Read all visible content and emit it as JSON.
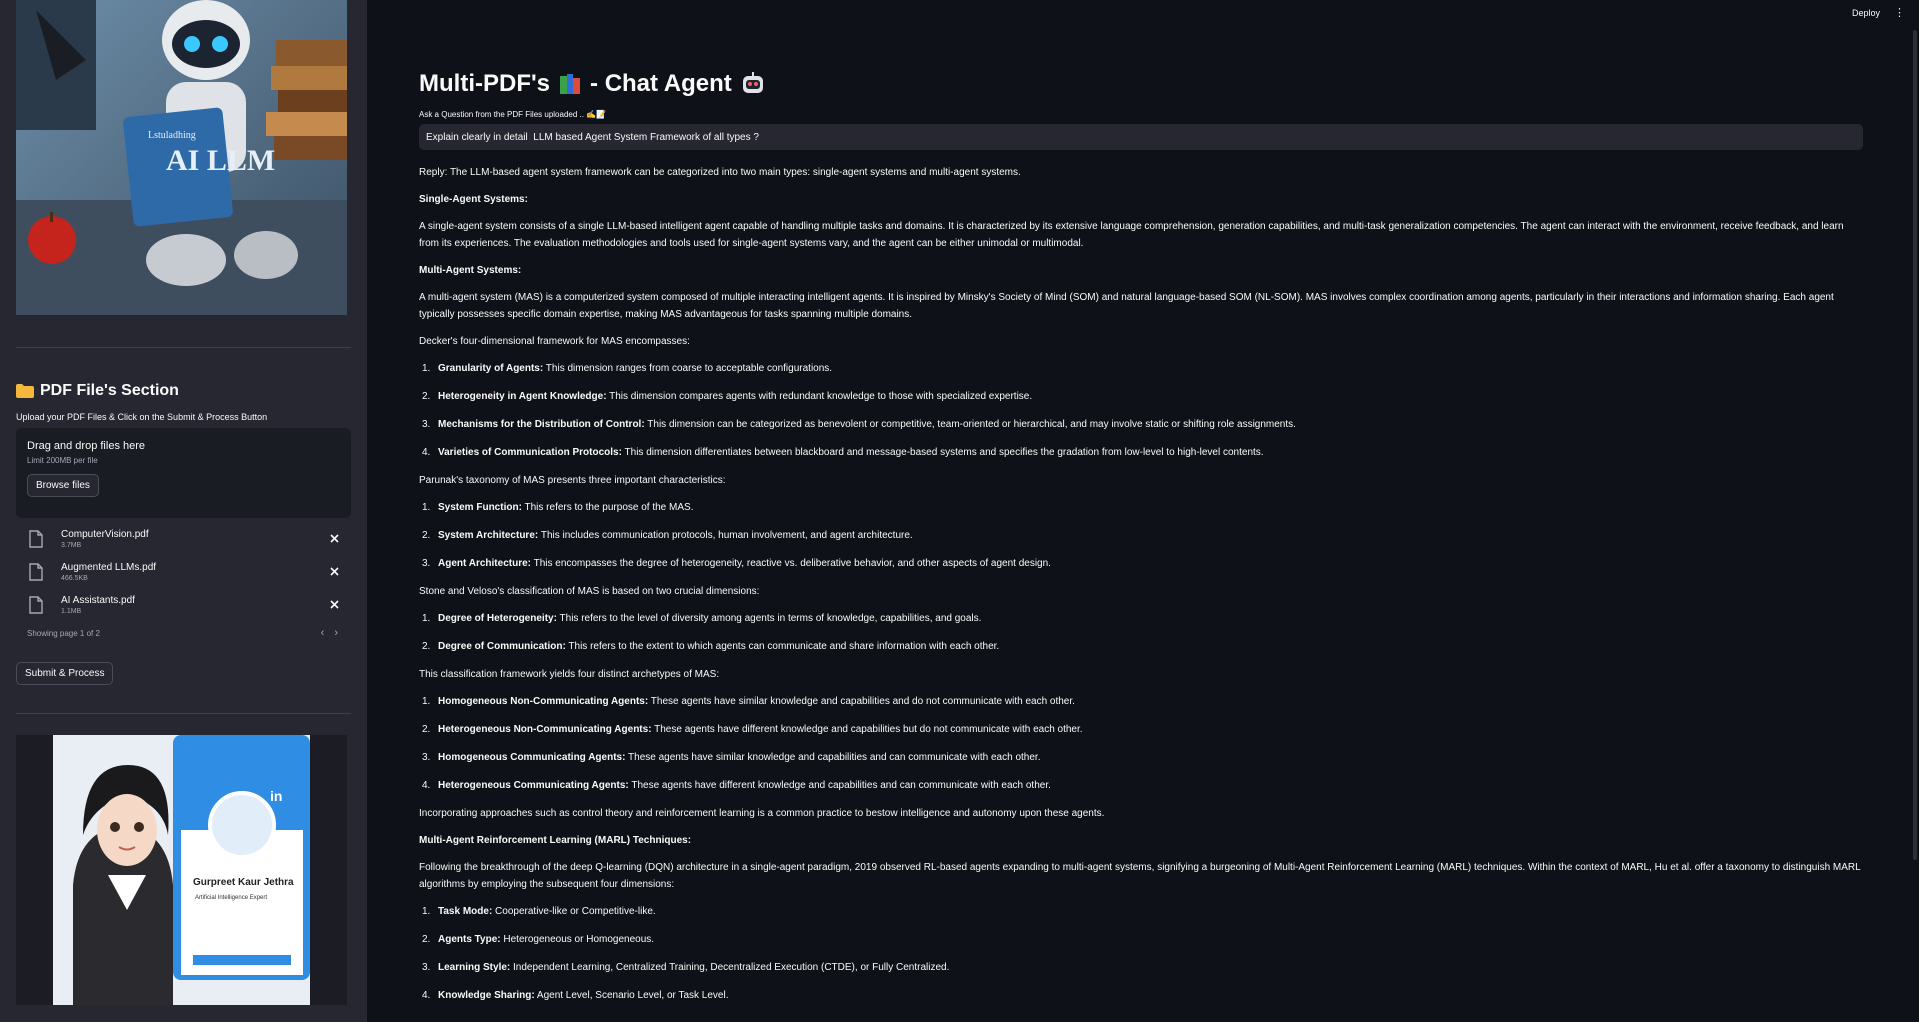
{
  "topbar": {
    "deploy_label": "Deploy",
    "menu_label": "⋮"
  },
  "sidebar": {
    "section_title": "PDF File's Section",
    "helper_text": "Upload your PDF Files & Click on the Submit & Process Button",
    "dropzone": {
      "title": "Drag and drop files here",
      "limit": "Limit 200MB per file",
      "browse_label": "Browse files"
    },
    "files": [
      {
        "name": "ComputerVision.pdf",
        "size": "3.7MB"
      },
      {
        "name": "Augmented LLMs.pdf",
        "size": "466.5KB"
      },
      {
        "name": "AI Assistants.pdf",
        "size": "1.1MB"
      }
    ],
    "pager_text": "Showing page 1 of 2",
    "submit_label": "Submit & Process",
    "hero_book_text": "AI LLM",
    "hero_book_sub": "Lstuladhing",
    "profile_name": "Gurpreet Kaur Jethra",
    "profile_role": "Artificial Intelligence Expert",
    "profile_badge": "in"
  },
  "main": {
    "title": "Multi-PDF's",
    "title_suffix": "- Chat Agent",
    "ask_label": "Ask a Question from the PDF Files uploaded .. ✍️📝",
    "question_value": "Explain clearly in detail  LLM based Agent System Framework of all types ?",
    "answer": {
      "reply": "Reply: The LLM-based agent system framework can be categorized into two main types: single-agent systems and multi-agent systems.",
      "single_head": "Single-Agent Systems:",
      "single_body": "A single-agent system consists of a single LLM-based intelligent agent capable of handling multiple tasks and domains. It is characterized by its extensive language comprehension, generation capabilities, and multi-task generalization competencies. The agent can interact with the environment, receive feedback, and learn from its experiences. The evaluation methodologies and tools used for single-agent systems vary, and the agent can be either unimodal or multimodal.",
      "multi_head": "Multi-Agent Systems:",
      "multi_body": "A multi-agent system (MAS) is a computerized system composed of multiple interacting intelligent agents. It is inspired by Minsky's Society of Mind (SOM) and natural language-based SOM (NL-SOM). MAS involves complex coordination among agents, particularly in their interactions and information sharing. Each agent typically possesses specific domain expertise, making MAS advantageous for tasks spanning multiple domains.",
      "decker_intro": "Decker's four-dimensional framework for MAS encompasses:",
      "decker": [
        {
          "num": "1.",
          "b": "Granularity of Agents:",
          "t": " This dimension ranges from coarse to acceptable configurations."
        },
        {
          "num": "2.",
          "b": "Heterogeneity in Agent Knowledge:",
          "t": " This dimension compares agents with redundant knowledge to those with specialized expertise."
        },
        {
          "num": "3.",
          "b": "Mechanisms for the Distribution of Control:",
          "t": " This dimension can be categorized as benevolent or competitive, team-oriented or hierarchical, and may involve static or shifting role assignments."
        },
        {
          "num": "4.",
          "b": "Varieties of Communication Protocols:",
          "t": " This dimension differentiates between blackboard and message-based systems and specifies the gradation from low-level to high-level contents."
        }
      ],
      "parunak_intro": "Parunak's taxonomy of MAS presents three important characteristics:",
      "parunak": [
        {
          "num": "1.",
          "b": "System Function:",
          "t": " This refers to the purpose of the MAS."
        },
        {
          "num": "2.",
          "b": "System Architecture:",
          "t": " This includes communication protocols, human involvement, and agent architecture."
        },
        {
          "num": "3.",
          "b": "Agent Architecture:",
          "t": " This encompasses the degree of heterogeneity, reactive vs. deliberative behavior, and other aspects of agent design."
        }
      ],
      "stone_intro": "Stone and Veloso's classification of MAS is based on two crucial dimensions:",
      "stone": [
        {
          "num": "1.",
          "b": "Degree of Heterogeneity:",
          "t": " This refers to the level of diversity among agents in terms of knowledge, capabilities, and goals."
        },
        {
          "num": "2.",
          "b": "Degree of Communication:",
          "t": " This refers to the extent to which agents can communicate and share information with each other."
        }
      ],
      "archetype_intro": "This classification framework yields four distinct archetypes of MAS:",
      "archetypes": [
        {
          "num": "1.",
          "b": "Homogeneous Non-Communicating Agents:",
          "t": " These agents have similar knowledge and capabilities and do not communicate with each other."
        },
        {
          "num": "2.",
          "b": "Heterogeneous Non-Communicating Agents:",
          "t": " These agents have different knowledge and capabilities but do not communicate with each other."
        },
        {
          "num": "3.",
          "b": "Homogeneous Communicating Agents:",
          "t": " These agents have similar knowledge and capabilities and can communicate with each other."
        },
        {
          "num": "4.",
          "b": "Heterogeneous Communicating Agents:",
          "t": " These agents have different knowledge and capabilities and can communicate with each other."
        }
      ],
      "approaches": "Incorporating approaches such as control theory and reinforcement learning is a common practice to bestow intelligence and autonomy upon these agents.",
      "marl_head": "Multi-Agent Reinforcement Learning (MARL) Techniques:",
      "marl_body": "Following the breakthrough of the deep Q-learning (DQN) architecture in a single-agent paradigm, 2019 observed RL-based agents expanding to multi-agent systems, signifying a burgeoning of Multi-Agent Reinforcement Learning (MARL) techniques. Within the context of MARL, Hu et al. offer a taxonomy to distinguish MARL algorithms by employing the subsequent four dimensions:",
      "marl": [
        {
          "num": "1.",
          "b": "Task Mode:",
          "t": " Cooperative-like or Competitive-like."
        },
        {
          "num": "2.",
          "b": "Agents Type:",
          "t": " Heterogeneous or Homogeneous."
        },
        {
          "num": "3.",
          "b": "Learning Style:",
          "t": " Independent Learning, Centralized Training, Decentralized Execution (CTDE), or Fully Centralized."
        },
        {
          "num": "4.",
          "b": "Knowledge Sharing:",
          "t": " Agent Level, Scenario Level, or Task Level."
        }
      ]
    }
  }
}
